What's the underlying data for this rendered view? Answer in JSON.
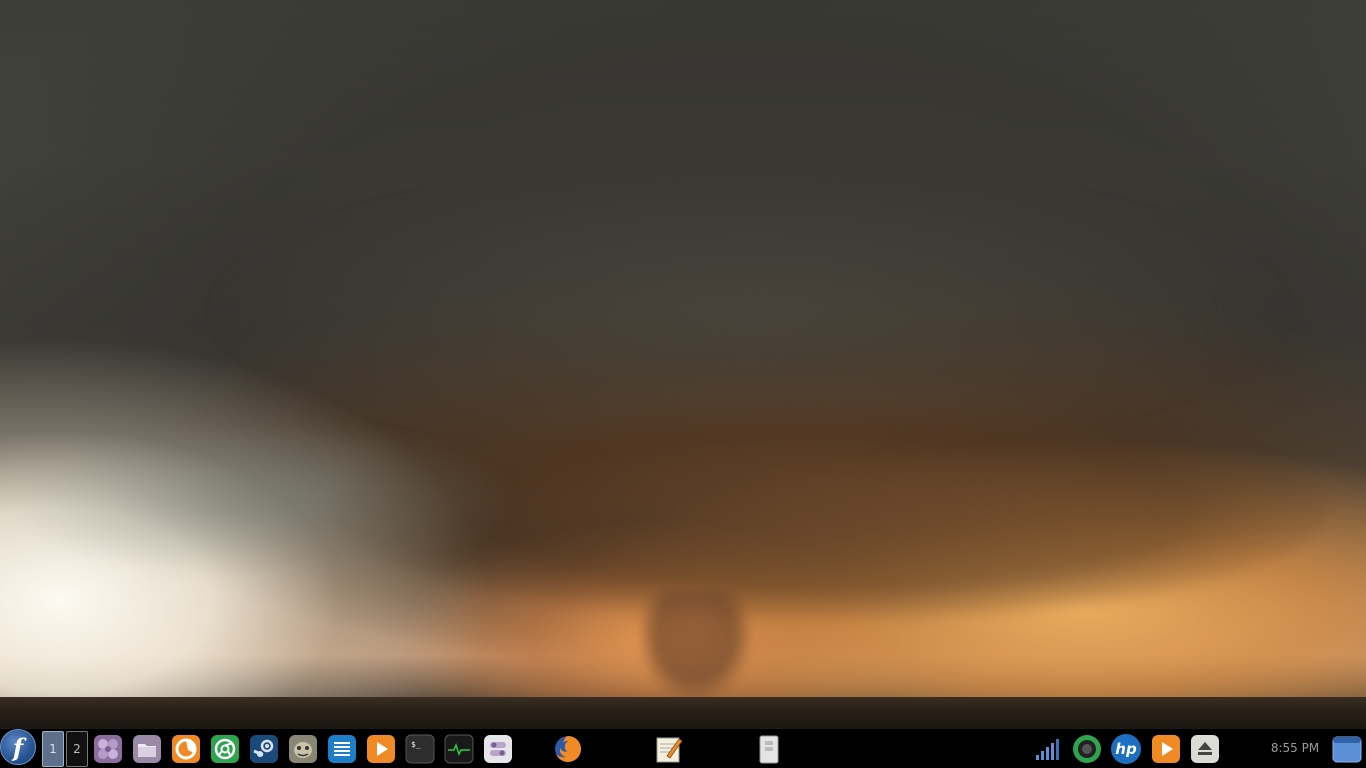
{
  "desktop": {
    "wallpaper": "storm-supercell-wallpaper"
  },
  "taskbar": {
    "start_icon": "fedora-logo-icon",
    "start_glyph": "f",
    "workspaces": [
      {
        "label": "1",
        "active": true
      },
      {
        "label": "2",
        "active": false
      }
    ],
    "launchers": [
      {
        "name": "xfce-settings-icon"
      },
      {
        "name": "file-manager-icon"
      },
      {
        "name": "firefox-launcher-icon"
      },
      {
        "name": "chrome-icon"
      },
      {
        "name": "steam-icon"
      },
      {
        "name": "gimp-icon"
      },
      {
        "name": "text-document-icon"
      },
      {
        "name": "media-player-icon"
      },
      {
        "name": "terminal-icon"
      },
      {
        "name": "system-monitor-icon"
      },
      {
        "name": "settings-toggle-icon"
      }
    ],
    "windows": [
      {
        "name": "firefox-window-icon"
      },
      {
        "name": "text-editor-window-icon"
      },
      {
        "name": "archive-window-icon"
      }
    ],
    "tray": [
      {
        "name": "network-signal-icon"
      },
      {
        "name": "disk-usage-icon"
      },
      {
        "name": "hp-printer-icon"
      },
      {
        "name": "media-player-tray-icon"
      },
      {
        "name": "eject-icon"
      }
    ],
    "terminal_prompt": "$_",
    "clock": "8:55 PM",
    "show_desktop_icon": "show-desktop-icon",
    "colors": {
      "background": "#000000",
      "fedora_blue": "#2b5796",
      "accent_orange": "#f08a24",
      "chrome_green": "#2ea44f",
      "steam_blue": "#1b4a7a"
    }
  }
}
